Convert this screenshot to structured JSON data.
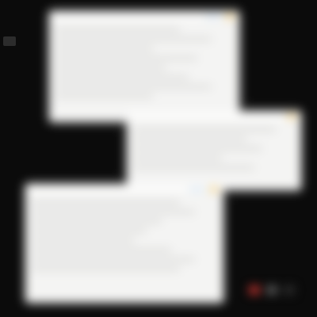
{
  "colors": {
    "desktop_background": "#0b0b0b",
    "window_background": "#f4f4f3",
    "accent_yellow": "#f3d79a",
    "accent_blue": "#cfe1f2",
    "dock_red": "#b3302c"
  },
  "windows": [
    {
      "title": ""
    },
    {
      "title": ""
    },
    {
      "title": ""
    }
  ],
  "dock": {
    "icons": [
      "app-icon-red",
      "app-icon-grey",
      "app-icon-dark"
    ]
  }
}
